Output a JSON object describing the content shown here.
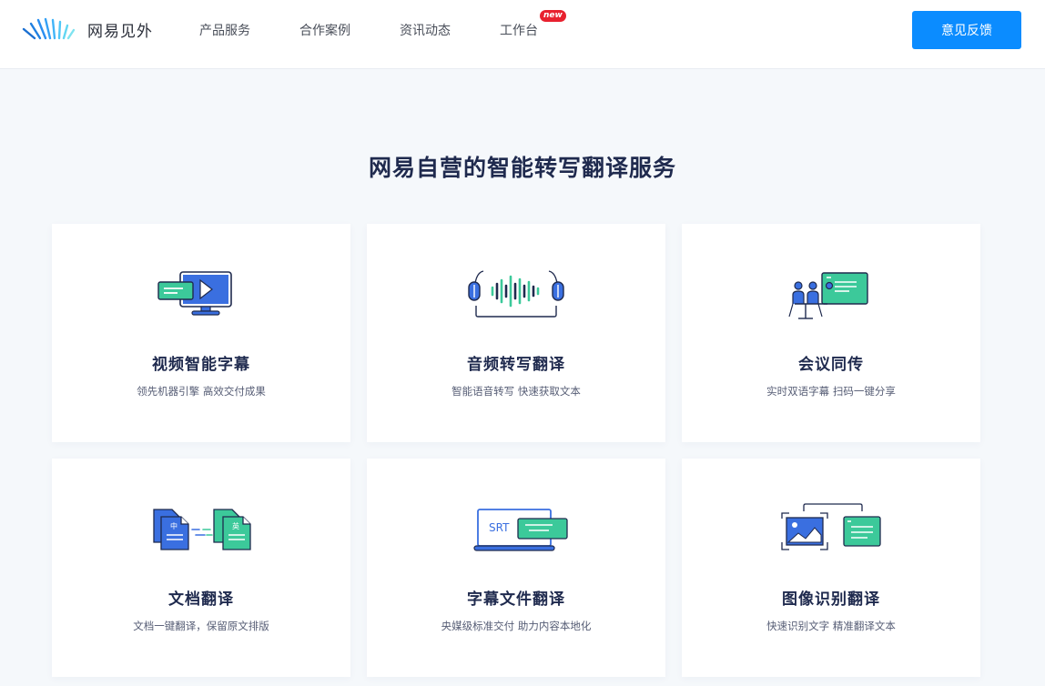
{
  "header": {
    "logo_text": "网易见外",
    "nav": [
      {
        "label": "产品服务"
      },
      {
        "label": "合作案例"
      },
      {
        "label": "资讯动态"
      },
      {
        "label": "工作台",
        "badge": "new"
      }
    ],
    "feedback_label": "意见反馈"
  },
  "colors": {
    "accent": "#0b8cff",
    "icon_blue": "#3a6fe0",
    "icon_green": "#3cc99a",
    "badge_red": "#e8212f",
    "title": "#1f2a4e"
  },
  "main": {
    "title": "网易自营的智能转写翻译服务",
    "cards": [
      {
        "title": "视频智能字幕",
        "desc": "领先机器引擎 高效交付成果",
        "icon": "video-subtitle-icon"
      },
      {
        "title": "音频转写翻译",
        "desc": "智能语音转写 快速获取文本",
        "icon": "headphones-waveform-icon"
      },
      {
        "title": "会议同传",
        "desc": "实时双语字幕 扫码一键分享",
        "icon": "meeting-interpret-icon"
      },
      {
        "title": "文档翻译",
        "desc": "文档一键翻译，保留原文排版",
        "icon": "document-translate-icon",
        "icon_labels": [
          "中",
          "英"
        ]
      },
      {
        "title": "字幕文件翻译",
        "desc": "央媒级标准交付 助力内容本地化",
        "icon": "srt-file-icon",
        "icon_label": "SRT"
      },
      {
        "title": "图像识别翻译",
        "desc": "快速识别文字 精准翻译文本",
        "icon": "image-recognition-icon"
      }
    ]
  }
}
